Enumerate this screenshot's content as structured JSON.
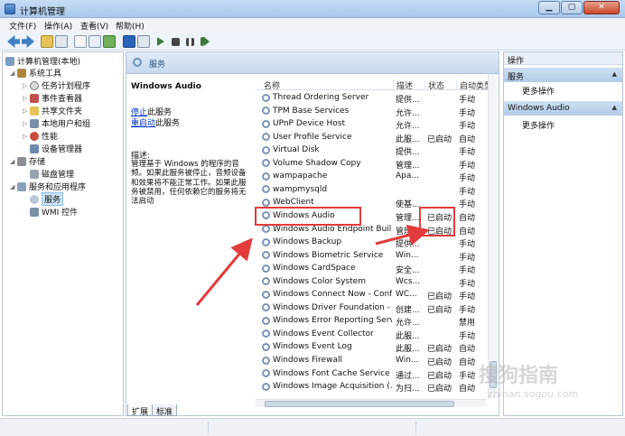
{
  "window": {
    "title": "计算机管理",
    "min": "▁",
    "max": "▢",
    "close": "✕"
  },
  "menu": [
    "文件(F)",
    "操作(A)",
    "查看(V)",
    "帮助(H)"
  ],
  "tree": [
    {
      "label": "计算机管理(本地)",
      "icon": "computer-icon"
    },
    {
      "label": "系统工具",
      "icon": "tools-icon"
    },
    {
      "label": "任务计划程序",
      "icon": "clock-icon"
    },
    {
      "label": "事件查看器",
      "icon": "event-viewer-icon"
    },
    {
      "label": "共享文件夹",
      "icon": "folder-icon"
    },
    {
      "label": "本地用户和组",
      "icon": "users-icon"
    },
    {
      "label": "性能",
      "icon": "performance-icon"
    },
    {
      "label": "设备管理器",
      "icon": "device-icon"
    },
    {
      "label": "存储",
      "icon": "storage-icon"
    },
    {
      "label": "磁盘管理",
      "icon": "disk-icon"
    },
    {
      "label": "服务和应用程序",
      "icon": "services-apps-icon"
    },
    {
      "label": "服务",
      "icon": "services-icon"
    },
    {
      "label": "WMI 控件",
      "icon": "wmi-icon"
    }
  ],
  "center": {
    "header": "服务",
    "desc": {
      "title": "Windows Audio",
      "stop_link": "停止",
      "stop_suffix": "此服务",
      "restart_link": "重启动",
      "restart_suffix": "此服务",
      "label": "描述:",
      "text": "管理基于 Windows 的程序的音频。如果此服务被停止，音频设备和效果将不能正常工作。如果此服务被禁用，任何依赖它的服务将无法启动"
    },
    "columns": [
      "名称",
      "描述",
      "状态",
      "启动类型"
    ],
    "rows": [
      {
        "name": "Thread Ordering Server",
        "desc": "提供...",
        "status": "",
        "start": "手动"
      },
      {
        "name": "TPM Base Services",
        "desc": "允许...",
        "status": "",
        "start": "手动"
      },
      {
        "name": "UPnP Device Host",
        "desc": "允许...",
        "status": "",
        "start": "手动"
      },
      {
        "name": "User Profile Service",
        "desc": "此服...",
        "status": "已启动",
        "start": "自动"
      },
      {
        "name": "Virtual Disk",
        "desc": "提供...",
        "status": "",
        "start": "手动"
      },
      {
        "name": "Volume Shadow Copy",
        "desc": "管理...",
        "status": "",
        "start": "手动"
      },
      {
        "name": "wampapache",
        "desc": "Apa...",
        "status": "",
        "start": "手动"
      },
      {
        "name": "wampmysqld",
        "desc": "",
        "status": "",
        "start": "手动"
      },
      {
        "name": "WebClient",
        "desc": "使基...",
        "status": "",
        "start": "手动"
      },
      {
        "name": "Windows Audio",
        "desc": "管理...",
        "status": "已启动",
        "start": "自动"
      },
      {
        "name": "Windows Audio Endpoint Buil...",
        "desc": "管理...",
        "status": "已启动",
        "start": "自动"
      },
      {
        "name": "Windows Backup",
        "desc": "提供...",
        "status": "",
        "start": "手动"
      },
      {
        "name": "Windows Biometric Service",
        "desc": "Win...",
        "status": "",
        "start": "手动"
      },
      {
        "name": "Windows CardSpace",
        "desc": "安全...",
        "status": "",
        "start": "手动"
      },
      {
        "name": "Windows Color System",
        "desc": "Wcs...",
        "status": "",
        "start": "手动"
      },
      {
        "name": "Windows Connect Now - Confi...",
        "desc": "WC...",
        "status": "已启动",
        "start": "手动"
      },
      {
        "name": "Windows Driver Foundation - ...",
        "desc": "创建...",
        "status": "已启动",
        "start": "手动"
      },
      {
        "name": "Windows Error Reporting Serv...",
        "desc": "允许...",
        "status": "",
        "start": "禁用"
      },
      {
        "name": "Windows Event Collector",
        "desc": "此服...",
        "status": "",
        "start": "手动"
      },
      {
        "name": "Windows Event Log",
        "desc": "此服...",
        "status": "已启动",
        "start": "自动"
      },
      {
        "name": "Windows Firewall",
        "desc": "Win...",
        "status": "已启动",
        "start": "自动"
      },
      {
        "name": "Windows Font Cache Service",
        "desc": "通过...",
        "status": "已启动",
        "start": "手动"
      },
      {
        "name": "Windows Image Acquisition (...",
        "desc": "为扫...",
        "status": "已启动",
        "start": "自动"
      }
    ],
    "tabs": [
      "扩展",
      "标准"
    ]
  },
  "actions": {
    "header": "操作",
    "sections": [
      {
        "title": "服务",
        "item": "更多操作"
      },
      {
        "title": "Windows Audio",
        "item": "更多操作"
      }
    ]
  },
  "watermark": {
    "main": "搜狗指南",
    "sub": "zhinan.sogou.com"
  },
  "colors": {
    "annotation": "#e23b3b",
    "link": "#0033cc",
    "selection": "#cce3f7"
  }
}
